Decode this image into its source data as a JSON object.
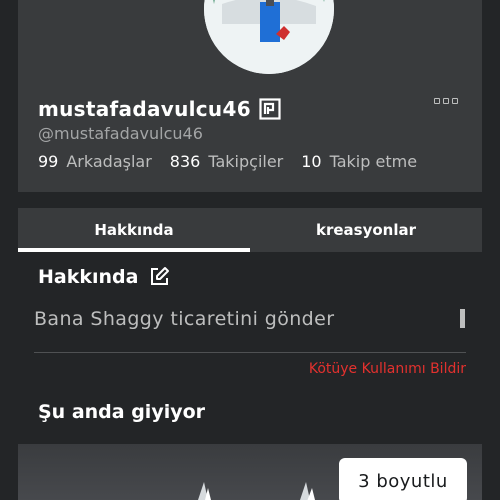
{
  "profile": {
    "display_name": "mustafadavulcu46",
    "handle": "@mustafadavulcu46",
    "stats": [
      {
        "count": "99",
        "label": "Arkadaşlar"
      },
      {
        "count": "836",
        "label": "Takipçiler"
      },
      {
        "count": "10",
        "label": "Takip etme"
      }
    ],
    "premium_icon": "premium-badge-icon",
    "more_icon": "more-options-icon"
  },
  "tabs": [
    {
      "label": "Hakkında",
      "active": true
    },
    {
      "label": "kreasyonlar",
      "active": false
    }
  ],
  "about": {
    "title": "Hakkında",
    "edit_icon": "edit-icon",
    "bio": "Bana Shaggy ticaretini gönder",
    "report_label": "Kötüye Kullanımı Bildir"
  },
  "wearing": {
    "title": "Şu anda giyiyor",
    "view_3d_label": "3 boyutlu"
  },
  "colors": {
    "background": "#232527",
    "card": "#393b3d",
    "report": "#e2312e"
  }
}
